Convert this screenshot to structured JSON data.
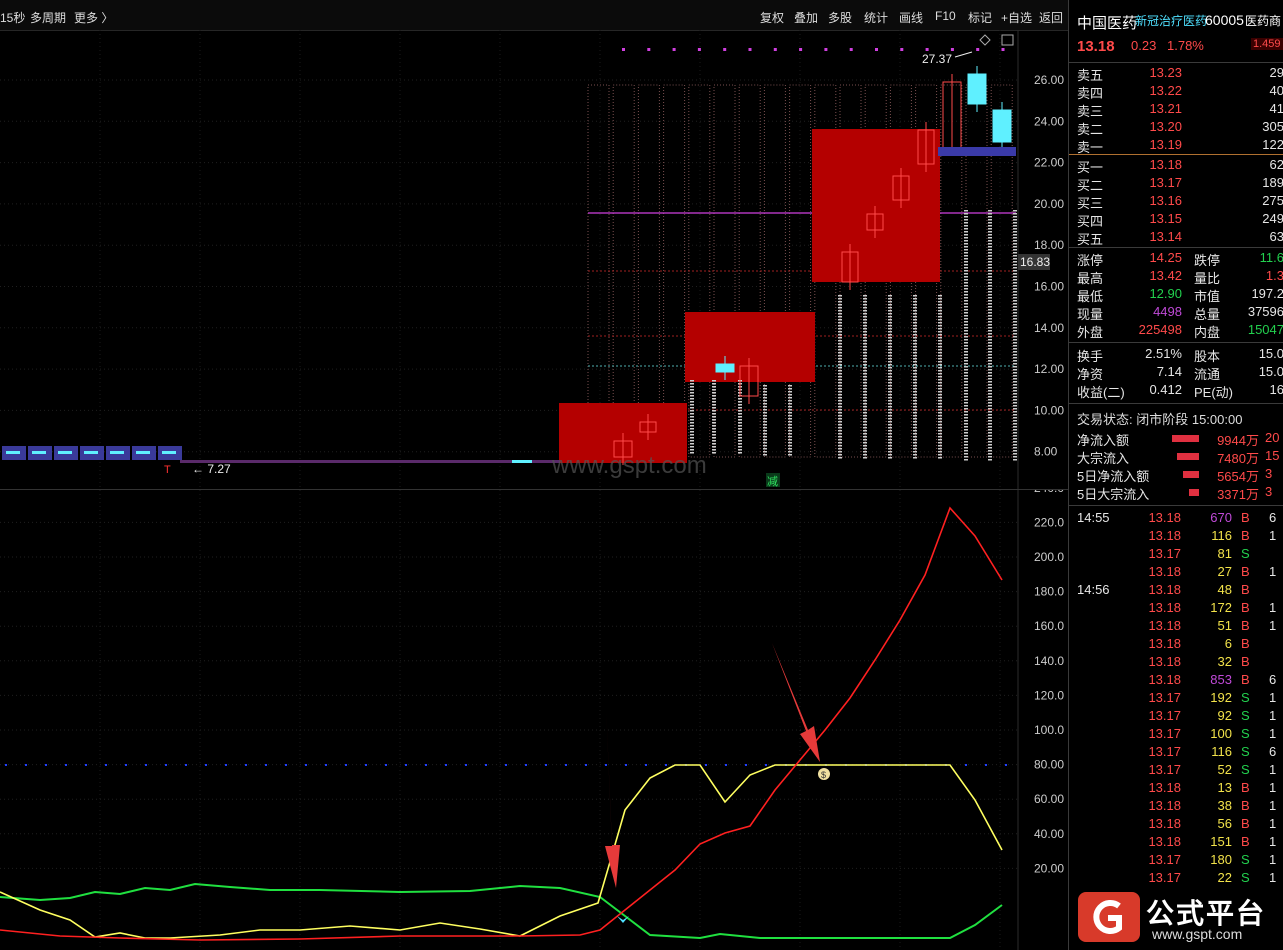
{
  "toolbar": {
    "period": "15秒",
    "multi_period": "多周期",
    "more": "更多 〉",
    "right_items": [
      "复权",
      "叠加",
      "多股",
      "统计",
      "画线",
      "F10",
      "标记",
      "+自选",
      "返回"
    ]
  },
  "main_chart": {
    "y_ticks": [
      "26.00",
      "24.00",
      "22.00",
      "20.00",
      "18.00",
      "16.00",
      "14.00",
      "12.00",
      "10.00",
      "8.00"
    ],
    "current_price_tag": "16.83",
    "high_label": "27.37",
    "low_label": "← 7.27",
    "watermark": "www.gspt.com",
    "jian_label": "减",
    "colors": {
      "box": "#b80000",
      "cyan": "#5ff0ff",
      "magenta": "#d040e0"
    }
  },
  "sub_chart": {
    "y_ticks": [
      "240.0",
      "220.0",
      "200.0",
      "180.0",
      "160.0",
      "140.0",
      "120.0",
      "100.0",
      "80.00",
      "60.00",
      "40.00",
      "20.00"
    ],
    "colors": {
      "red": "#ff2020",
      "yellow": "#ffff60",
      "green": "#20e040",
      "dotted": "#2040ff"
    }
  },
  "quote": {
    "name": "中国医药",
    "concept": "新冠治疗医药",
    "code": "60005",
    "industry": "医药商",
    "price": "13.18",
    "change": "0.23",
    "change_pct": "1.78%",
    "badge": "1.459",
    "asks": [
      {
        "label": "卖五",
        "price": "13.23",
        "vol": "29"
      },
      {
        "label": "卖四",
        "price": "13.22",
        "vol": "40"
      },
      {
        "label": "卖三",
        "price": "13.21",
        "vol": "41"
      },
      {
        "label": "卖二",
        "price": "13.20",
        "vol": "305"
      },
      {
        "label": "卖一",
        "price": "13.19",
        "vol": "122"
      }
    ],
    "bids": [
      {
        "label": "买一",
        "price": "13.18",
        "vol": "62"
      },
      {
        "label": "买二",
        "price": "13.17",
        "vol": "189"
      },
      {
        "label": "买三",
        "price": "13.16",
        "vol": "275"
      },
      {
        "label": "买四",
        "price": "13.15",
        "vol": "249"
      },
      {
        "label": "买五",
        "price": "13.14",
        "vol": "63"
      }
    ],
    "stats": [
      {
        "k1": "涨停",
        "v1": "14.25",
        "c1": "red",
        "k2": "跌停",
        "v2": "11.6",
        "c2": "green"
      },
      {
        "k1": "最高",
        "v1": "13.42",
        "c1": "red",
        "k2": "量比",
        "v2": "1.3",
        "c2": "red"
      },
      {
        "k1": "最低",
        "v1": "12.90",
        "c1": "green",
        "k2": "市值",
        "v2": "197.2",
        "c2": "white"
      },
      {
        "k1": "现量",
        "v1": "4498",
        "c1": "purple",
        "k2": "总量",
        "v2": "37596",
        "c2": "white"
      },
      {
        "k1": "外盘",
        "v1": "225498",
        "c1": "red",
        "k2": "内盘",
        "v2": "15047",
        "c2": "green"
      }
    ],
    "stats2": [
      {
        "k1": "换手",
        "v1": "2.51%",
        "k2": "股本",
        "v2": "15.0"
      },
      {
        "k1": "净资",
        "v1": "7.14",
        "k2": "流通",
        "v2": "15.0"
      },
      {
        "k1": "收益(二)",
        "v1": "0.412",
        "k2": "PE(动)",
        "v2": "16"
      }
    ],
    "trade_status": "交易状态: 闭市阶段 15:00:00",
    "flows": [
      {
        "label": "净流入额",
        "value": "9944万",
        "extra": "20",
        "bar": 0.9
      },
      {
        "label": "大宗流入",
        "value": "7480万",
        "extra": "15",
        "bar": 0.75
      },
      {
        "label": "5日净流入额",
        "value": "5654万",
        "extra": "3",
        "bar": 0.55
      },
      {
        "label": "5日大宗流入",
        "value": "3371万",
        "extra": "3",
        "bar": 0.35
      }
    ],
    "ticks": [
      {
        "time": "14:55",
        "price": "13.18",
        "vol": "670",
        "vc": "purple",
        "bs": "B",
        "x": "6"
      },
      {
        "time": "",
        "price": "13.18",
        "vol": "116",
        "vc": "yellow",
        "bs": "B",
        "x": "1"
      },
      {
        "time": "",
        "price": "13.17",
        "vol": "81",
        "vc": "yellow",
        "bs": "S",
        "x": ""
      },
      {
        "time": "",
        "price": "13.18",
        "vol": "27",
        "vc": "yellow",
        "bs": "B",
        "x": "1"
      },
      {
        "time": "14:56",
        "price": "13.18",
        "vol": "48",
        "vc": "yellow",
        "bs": "B",
        "x": ""
      },
      {
        "time": "",
        "price": "13.18",
        "vol": "172",
        "vc": "yellow",
        "bs": "B",
        "x": "1"
      },
      {
        "time": "",
        "price": "13.18",
        "vol": "51",
        "vc": "yellow",
        "bs": "B",
        "x": "1"
      },
      {
        "time": "",
        "price": "13.18",
        "vol": "6",
        "vc": "yellow",
        "bs": "B",
        "x": ""
      },
      {
        "time": "",
        "price": "13.18",
        "vol": "32",
        "vc": "yellow",
        "bs": "B",
        "x": ""
      },
      {
        "time": "",
        "price": "13.18",
        "vol": "853",
        "vc": "purple",
        "bs": "B",
        "x": "6"
      },
      {
        "time": "",
        "price": "13.17",
        "vol": "192",
        "vc": "yellow",
        "bs": "S",
        "x": "1"
      },
      {
        "time": "",
        "price": "13.17",
        "vol": "92",
        "vc": "yellow",
        "bs": "S",
        "x": "1"
      },
      {
        "time": "",
        "price": "13.17",
        "vol": "100",
        "vc": "yellow",
        "bs": "S",
        "x": "1"
      },
      {
        "time": "",
        "price": "13.17",
        "vol": "116",
        "vc": "yellow",
        "bs": "S",
        "x": "6"
      },
      {
        "time": "",
        "price": "13.17",
        "vol": "52",
        "vc": "yellow",
        "bs": "S",
        "x": "1"
      },
      {
        "time": "",
        "price": "13.18",
        "vol": "13",
        "vc": "yellow",
        "bs": "B",
        "x": "1"
      },
      {
        "time": "",
        "price": "13.18",
        "vol": "38",
        "vc": "yellow",
        "bs": "B",
        "x": "1"
      },
      {
        "time": "",
        "price": "13.18",
        "vol": "56",
        "vc": "yellow",
        "bs": "B",
        "x": "1"
      },
      {
        "time": "",
        "price": "13.18",
        "vol": "151",
        "vc": "yellow",
        "bs": "B",
        "x": "1"
      },
      {
        "time": "",
        "price": "13.17",
        "vol": "180",
        "vc": "yellow",
        "bs": "S",
        "x": "1"
      },
      {
        "time": "",
        "price": "13.17",
        "vol": "22",
        "vc": "yellow",
        "bs": "S",
        "x": "1"
      }
    ]
  },
  "logo": {
    "brand": "公式平台",
    "url": "www.gspt.com"
  }
}
